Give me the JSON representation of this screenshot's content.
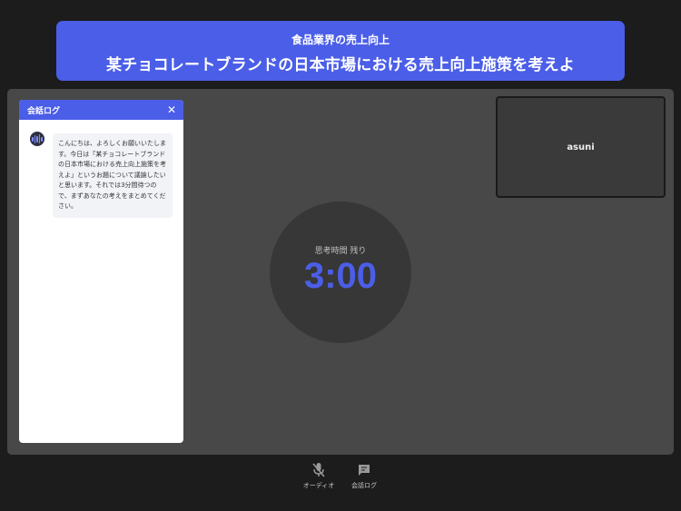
{
  "banner": {
    "subtitle": "食品業界の売上向上",
    "title": "某チョコレートブランドの日本市場における売上向上施策を考えよ"
  },
  "log_panel": {
    "title": "会話ログ",
    "close_icon": "close-icon",
    "messages": [
      {
        "sender_icon": "ai-avatar-icon",
        "text": "こんにちは、よろしくお願いいたします。今日は「某チョコレートブランドの日本市場における売上向上施策を考えよ」というお題について議論したいと思います。それでは3分間待つので、まずあなたの考えをまとめてください。"
      }
    ]
  },
  "participant": {
    "name": "asuni"
  },
  "timer": {
    "label": "思考時間 残り",
    "value": "3:00"
  },
  "controls": [
    {
      "icon": "mic-muted-icon",
      "label": "オーディオ"
    },
    {
      "icon": "chat-icon",
      "label": "会話ログ"
    }
  ],
  "colors": {
    "accent": "#4b5ee8",
    "background": "#1c1c1c",
    "stage": "#484848"
  }
}
